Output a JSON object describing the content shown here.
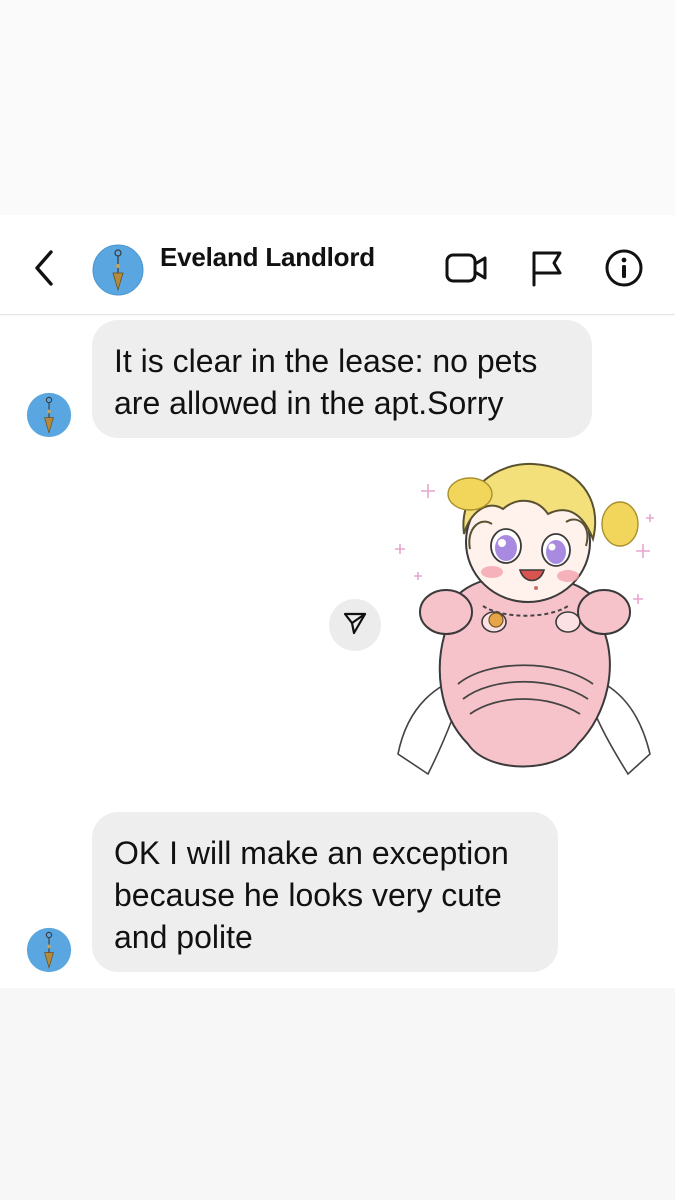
{
  "header": {
    "contact_name": "Eveland Landlord",
    "avatar_icon": "pendulum-icon",
    "back_icon": "chevron-left-icon",
    "actions": [
      "video-call-icon",
      "flag-icon",
      "info-icon"
    ]
  },
  "messages": [
    {
      "sender": "landlord",
      "text": "It is clear in the lease: no pets are allowed in the apt.Sorry"
    },
    {
      "sender": "me",
      "type": "sticker",
      "sticker_icon": "anime-puppy-child-sticker",
      "share_icon": "send-arrow-icon"
    },
    {
      "sender": "landlord",
      "text": "OK I will make an exception because he looks very cute and polite"
    }
  ],
  "colors": {
    "bubble_bg": "#eeeeee",
    "avatar_bg": "#5aa6e0",
    "header_bg": "#ffffff",
    "accent_hair": "#f3e07a",
    "accent_pink": "#f4b9c3"
  }
}
